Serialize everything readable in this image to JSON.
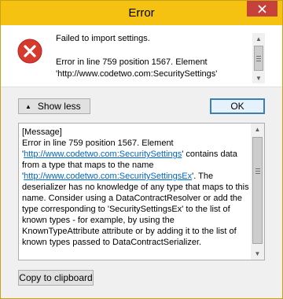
{
  "window": {
    "title": "Error"
  },
  "titlebar": {
    "close_icon": "close-icon",
    "close_color": "#c7413b",
    "bar_color": "#f5c211"
  },
  "message": {
    "icon": "error-icon",
    "icon_color": "#d63a2f",
    "summary": "Failed to import settings.",
    "detail_line1": "Error in line 759 position 1567. Element",
    "detail_line2": "'http://www.codetwo.com:SecuritySettings'"
  },
  "buttons": {
    "show_less": "Show less",
    "ok": "OK",
    "copy": "Copy to clipboard"
  },
  "details": {
    "header": "[Message]",
    "line1": "Error in line 759 position 1567. Element",
    "quote": "'",
    "link1": "http://www.codetwo.com:SecuritySettings",
    "after_link1": "' contains data from a type that maps to the name '",
    "link2": "http://www.codetwo.com:SecuritySettingsEx",
    "after_link2": "'. The deserializer has no knowledge of any type that maps to this name. Consider using a DataContractResolver or add the type corresponding to 'SecuritySettingsEx' to the list of known types - for example, by using the KnownTypeAttribute attribute or by adding it to the list of known types passed to DataContractSerializer."
  }
}
